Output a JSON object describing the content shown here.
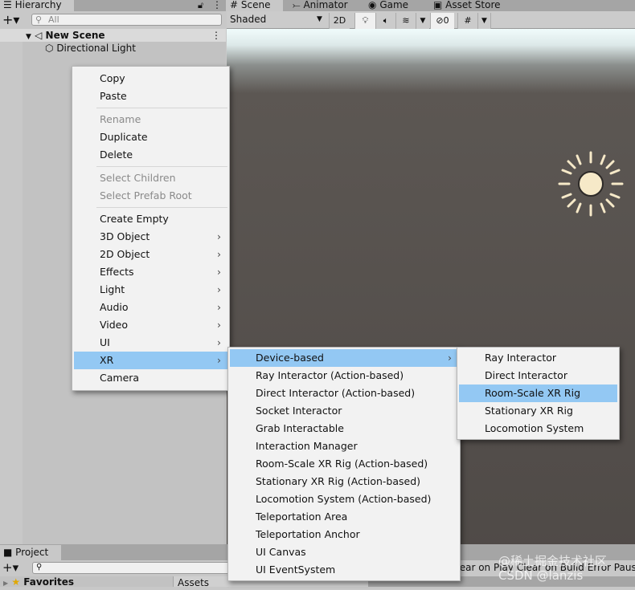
{
  "hierarchy": {
    "tab": "Hierarchy",
    "search_placeholder": "All",
    "scene": "New Scene",
    "items": [
      "Directional Light"
    ]
  },
  "scene_tabs": [
    "Scene",
    "Animator",
    "Game",
    "Asset Store"
  ],
  "scene_toolbar": {
    "shading": "Shaded",
    "mode_2d": "2D",
    "hidden_count": "0"
  },
  "project": {
    "tab": "Project",
    "favorites": "Favorites",
    "assets": "Assets"
  },
  "console": {
    "clear_on_play": "Clear on Play",
    "clear_on_build": "Clear on Build",
    "error_pause": "Error Pause"
  },
  "watermark": "@稀土掘金技术社区 CSDN @lanzis",
  "context_menu": {
    "groups": [
      [
        {
          "label": "Copy"
        },
        {
          "label": "Paste"
        }
      ],
      [
        {
          "label": "Rename",
          "disabled": true
        },
        {
          "label": "Duplicate"
        },
        {
          "label": "Delete"
        }
      ],
      [
        {
          "label": "Select Children",
          "disabled": true
        },
        {
          "label": "Select Prefab Root",
          "disabled": true
        }
      ],
      [
        {
          "label": "Create Empty"
        },
        {
          "label": "3D Object",
          "sub": true
        },
        {
          "label": "2D Object",
          "sub": true
        },
        {
          "label": "Effects",
          "sub": true
        },
        {
          "label": "Light",
          "sub": true
        },
        {
          "label": "Audio",
          "sub": true
        },
        {
          "label": "Video",
          "sub": true
        },
        {
          "label": "UI",
          "sub": true
        },
        {
          "label": "XR",
          "sub": true,
          "highlight": true
        },
        {
          "label": "Camera"
        }
      ]
    ]
  },
  "xr_menu": [
    {
      "label": "Device-based",
      "sub": true,
      "highlight": true
    },
    {
      "label": "Ray Interactor (Action-based)"
    },
    {
      "label": "Direct Interactor (Action-based)"
    },
    {
      "label": "Socket Interactor"
    },
    {
      "label": "Grab Interactable"
    },
    {
      "label": "Interaction Manager"
    },
    {
      "label": "Room-Scale XR Rig (Action-based)"
    },
    {
      "label": "Stationary XR Rig (Action-based)"
    },
    {
      "label": "Locomotion System (Action-based)"
    },
    {
      "label": "Teleportation Area"
    },
    {
      "label": "Teleportation Anchor"
    },
    {
      "label": "UI Canvas"
    },
    {
      "label": "UI EventSystem"
    }
  ],
  "device_menu": [
    {
      "label": "Ray Interactor"
    },
    {
      "label": "Direct Interactor"
    },
    {
      "label": "Room-Scale XR Rig",
      "highlight": true
    },
    {
      "label": "Stationary XR Rig"
    },
    {
      "label": "Locomotion System"
    }
  ]
}
